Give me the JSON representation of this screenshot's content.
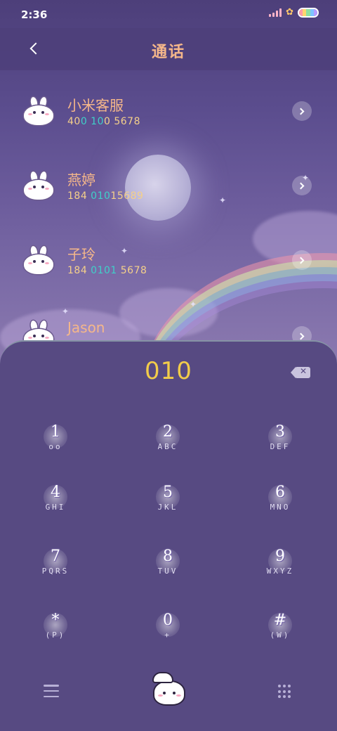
{
  "status_bar": {
    "time": "2:36"
  },
  "header": {
    "title": "通话"
  },
  "contacts": [
    {
      "name": "小米客服",
      "number_parts": [
        "40",
        "0 10",
        "0 5678"
      ]
    },
    {
      "name": "燕婷",
      "number_parts": [
        "184 ",
        "010",
        "15689"
      ]
    },
    {
      "name": "子玲",
      "number_parts": [
        "184 ",
        "0101",
        " 5678"
      ]
    },
    {
      "name": "Jason",
      "number_parts": [
        "",
        "",
        ""
      ]
    }
  ],
  "dialer": {
    "input_value": "010",
    "keys": [
      {
        "digit": "1",
        "letters": "oo"
      },
      {
        "digit": "2",
        "letters": "ABC"
      },
      {
        "digit": "3",
        "letters": "DEF"
      },
      {
        "digit": "4",
        "letters": "GHI"
      },
      {
        "digit": "5",
        "letters": "JKL"
      },
      {
        "digit": "6",
        "letters": "MNO"
      },
      {
        "digit": "7",
        "letters": "PQRS"
      },
      {
        "digit": "8",
        "letters": "TUV"
      },
      {
        "digit": "9",
        "letters": "WXYZ"
      },
      {
        "digit": "*",
        "letters": "(P)"
      },
      {
        "digit": "0",
        "letters": "+"
      },
      {
        "digit": "#",
        "letters": "(W)"
      }
    ]
  },
  "colors": {
    "accent_title": "#f5b78a",
    "dial_digits": "#f2cc4a",
    "number_highlight": "#3fd0c8",
    "panel": "#574a82"
  }
}
